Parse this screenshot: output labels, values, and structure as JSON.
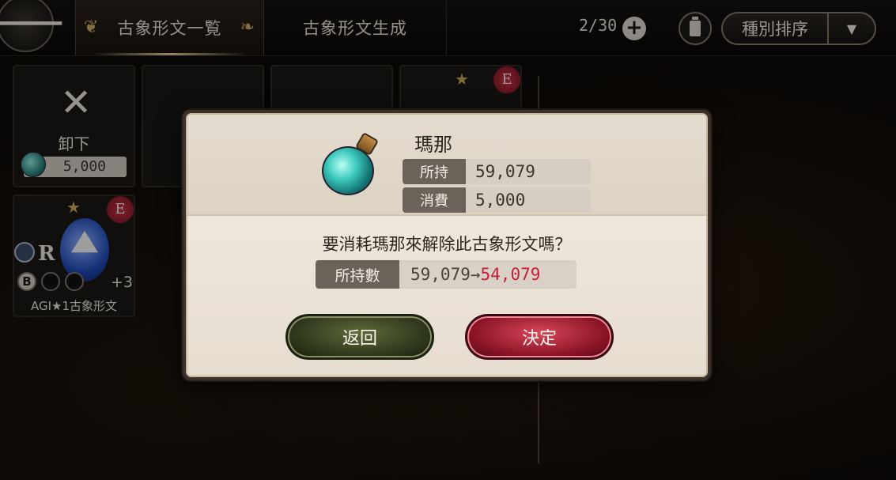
{
  "header": {
    "tab_active": "古象形文一覧",
    "tab_generate": "古象形文生成",
    "count": "2/30",
    "sort_label": "種別排序"
  },
  "grid": {
    "remove_label": "卸下",
    "remove_cost": "5,000",
    "badge": "E",
    "rune_rank": "R",
    "rune_slot_label": "B",
    "rune_bonus": "+3",
    "rune_name": "AGI★1古象形文"
  },
  "dialog": {
    "item_name": "瑪那",
    "owned_label": "所持",
    "owned_value": "59,079",
    "cost_label": "消費",
    "cost_value": "5,000",
    "question": "要消耗瑪那來解除此古象形文嗎？",
    "hold_label": "所持數",
    "hold_before": "59,079→",
    "hold_after": "54,079",
    "back_label": "返回",
    "confirm_label": "決定"
  },
  "colors": {
    "accent_red": "#c42039",
    "confirm_button": "#8b1426",
    "back_button": "#2c331a"
  }
}
